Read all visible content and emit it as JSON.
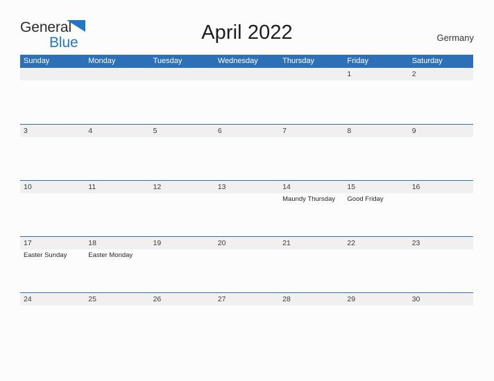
{
  "brand": {
    "name_part1": "General",
    "name_part2": "Blue",
    "flag_icon": "blue-triangle-flag-icon",
    "color_dark": "#2b2b2b",
    "color_blue": "#1f78c1"
  },
  "header": {
    "title": "April 2022",
    "country": "Germany"
  },
  "theme": {
    "header_blue": "#2e70b8",
    "row_divider_blue": "#2e70b8",
    "date_band_gray": "#f0f0f0",
    "page_background": "#fcfcfc",
    "text_dark": "#262626"
  },
  "calendar": {
    "month": "April",
    "year": "2022",
    "weekdays": [
      "Sunday",
      "Monday",
      "Tuesday",
      "Wednesday",
      "Thursday",
      "Friday",
      "Saturday"
    ],
    "weeks": [
      {
        "days": [
          {
            "date": "",
            "events": []
          },
          {
            "date": "",
            "events": []
          },
          {
            "date": "",
            "events": []
          },
          {
            "date": "",
            "events": []
          },
          {
            "date": "",
            "events": []
          },
          {
            "date": "1",
            "events": []
          },
          {
            "date": "2",
            "events": []
          }
        ]
      },
      {
        "days": [
          {
            "date": "3",
            "events": []
          },
          {
            "date": "4",
            "events": []
          },
          {
            "date": "5",
            "events": []
          },
          {
            "date": "6",
            "events": []
          },
          {
            "date": "7",
            "events": []
          },
          {
            "date": "8",
            "events": []
          },
          {
            "date": "9",
            "events": []
          }
        ]
      },
      {
        "days": [
          {
            "date": "10",
            "events": []
          },
          {
            "date": "11",
            "events": []
          },
          {
            "date": "12",
            "events": []
          },
          {
            "date": "13",
            "events": []
          },
          {
            "date": "14",
            "events": [
              "Maundy Thursday"
            ]
          },
          {
            "date": "15",
            "events": [
              "Good Friday"
            ]
          },
          {
            "date": "16",
            "events": []
          }
        ]
      },
      {
        "days": [
          {
            "date": "17",
            "events": [
              "Easter Sunday"
            ]
          },
          {
            "date": "18",
            "events": [
              "Easter Monday"
            ]
          },
          {
            "date": "19",
            "events": []
          },
          {
            "date": "20",
            "events": []
          },
          {
            "date": "21",
            "events": []
          },
          {
            "date": "22",
            "events": []
          },
          {
            "date": "23",
            "events": []
          }
        ]
      },
      {
        "days": [
          {
            "date": "24",
            "events": []
          },
          {
            "date": "25",
            "events": []
          },
          {
            "date": "26",
            "events": []
          },
          {
            "date": "27",
            "events": []
          },
          {
            "date": "28",
            "events": []
          },
          {
            "date": "29",
            "events": []
          },
          {
            "date": "30",
            "events": []
          }
        ]
      }
    ]
  }
}
